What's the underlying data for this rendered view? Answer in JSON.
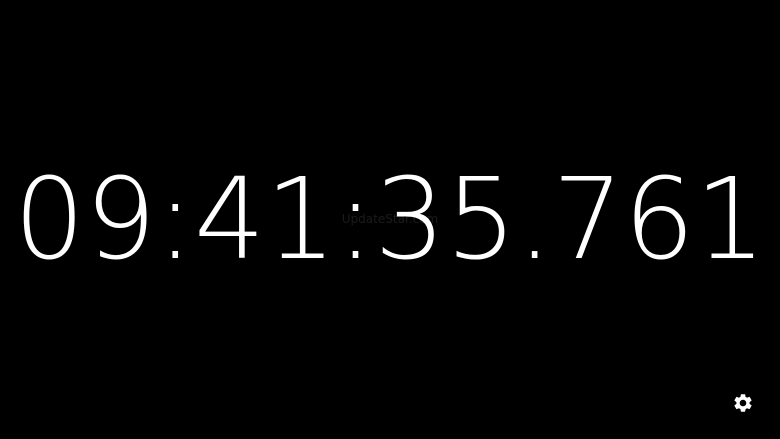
{
  "clock": {
    "time": "09:41:35.761",
    "watermark": "UpdateStar.com"
  },
  "colors": {
    "background": "#000000",
    "foreground": "#ffffff"
  },
  "controls": {
    "settings_icon": "gear-icon"
  }
}
